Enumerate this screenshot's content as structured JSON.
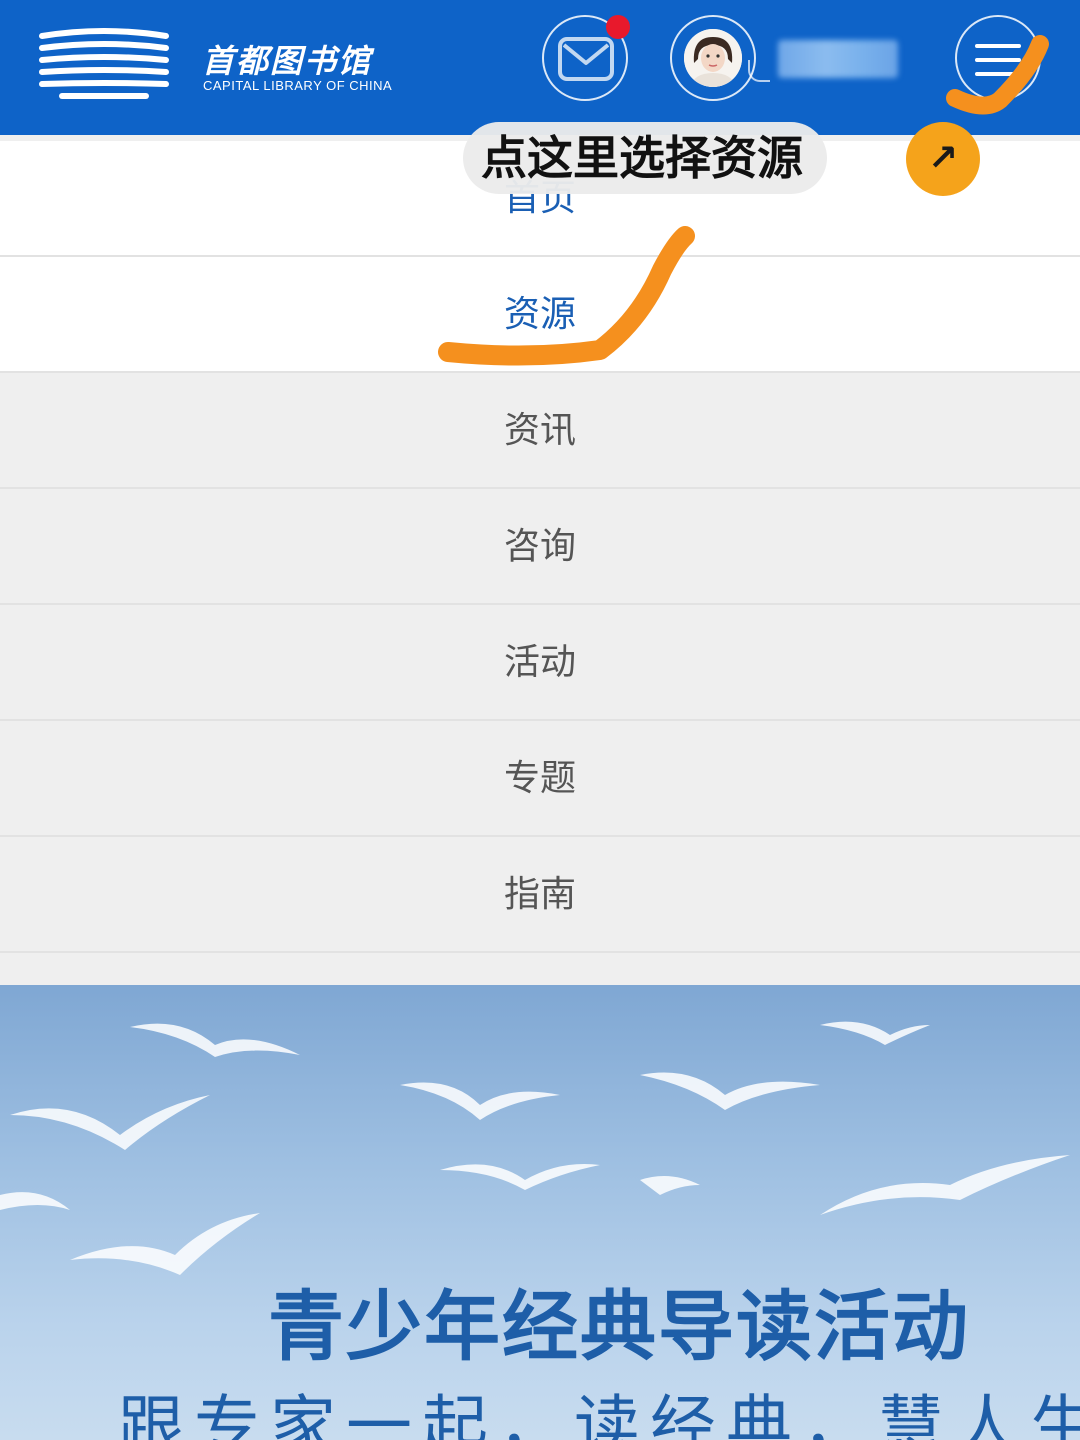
{
  "header": {
    "logo_name": "首都图书馆",
    "logo_subtitle": "CAPITAL LIBRARY OF CHINA",
    "icons": {
      "logo": "library-logo-icon",
      "message": "mail-icon",
      "menu": "hamburger-menu-icon"
    },
    "brand_color": "#0e63c8",
    "notification_color": "#e8192c"
  },
  "menu": {
    "items": [
      {
        "label": "首页"
      },
      {
        "label": "资源"
      },
      {
        "label": "资讯"
      },
      {
        "label": "咨询"
      },
      {
        "label": "活动"
      },
      {
        "label": "专题"
      },
      {
        "label": "指南"
      }
    ],
    "active_label": "资源"
  },
  "annotation": {
    "callout": "点这里选择资源",
    "arrow_glyph": "↗",
    "highlight_color": "#f5901e"
  },
  "banner": {
    "title": "青少年经典导读活动",
    "subtitle": "跟专家一起，读经典，慧人生"
  }
}
